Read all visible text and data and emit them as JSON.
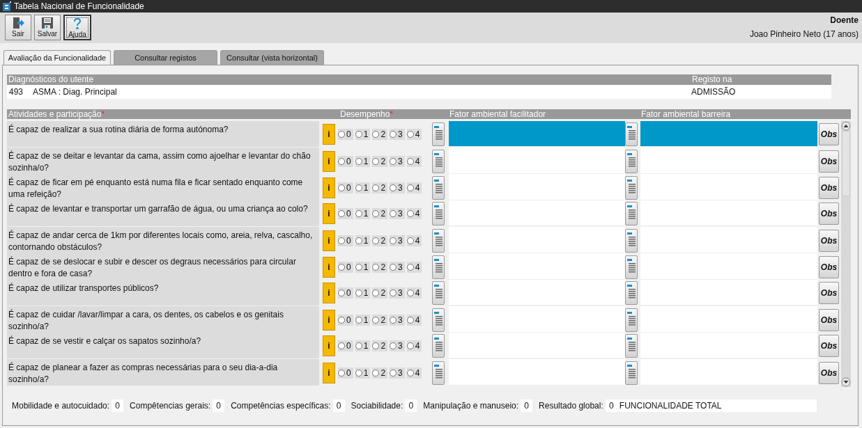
{
  "window": {
    "title": "Tabela Nacional de Funcionalidade"
  },
  "toolbar": {
    "buttons": [
      {
        "label": "Sair",
        "kind": "exit",
        "focused": false
      },
      {
        "label": "Salvar",
        "kind": "save",
        "focused": false
      },
      {
        "label": "Ajuda",
        "kind": "help",
        "focused": true
      }
    ]
  },
  "patient": {
    "heading": "Doente",
    "name": "Joao Pinheiro Neto (17 anos)"
  },
  "tabs": [
    {
      "label": "Avaliação da Funcionalidade",
      "selected": true
    },
    {
      "label": "Consultar registos",
      "selected": false
    },
    {
      "label": "Consultar (vista horizontal)",
      "selected": false
    }
  ],
  "diagnoses": {
    "columns": [
      "Diagnósticos do utente",
      "Registo na"
    ],
    "rows": [
      {
        "code": "493",
        "description": "ASMA : Diag. Principal",
        "registo": "ADMISSÃO"
      }
    ]
  },
  "activities": {
    "columns": [
      {
        "label": "Atividades e participação",
        "required_mark": "*"
      },
      {
        "label": "Desempenho",
        "required_mark": "*"
      },
      {
        "label": "Fator ambiental facilitador"
      },
      {
        "label": "Fator ambiental barreira"
      }
    ],
    "rows": [
      {
        "question": "É capaz de realizar a sua rotina diária de forma autónoma?",
        "selected": true,
        "info": "i",
        "obs": "Obs",
        "options": [
          {
            "label": "0",
            "selected": false
          },
          {
            "label": "1",
            "selected": false
          },
          {
            "label": "2",
            "selected": false
          },
          {
            "label": "3",
            "selected": false
          },
          {
            "label": "4",
            "selected": false
          }
        ]
      },
      {
        "question": "É capaz de se deitar e levantar da cama, assim como ajoelhar e levantar do chão sozinha/o?",
        "selected": false,
        "info": "i",
        "obs": "Obs",
        "options": [
          {
            "label": "0",
            "selected": false
          },
          {
            "label": "1",
            "selected": false
          },
          {
            "label": "2",
            "selected": false
          },
          {
            "label": "3",
            "selected": false
          },
          {
            "label": "4",
            "selected": false
          }
        ]
      },
      {
        "question": "É capaz de ficar em pé enquanto está numa fila e ficar sentado enquanto come uma refeição?",
        "selected": false,
        "info": "i",
        "obs": "Obs",
        "options": [
          {
            "label": "0",
            "selected": false
          },
          {
            "label": "1",
            "selected": false
          },
          {
            "label": "2",
            "selected": false
          },
          {
            "label": "3",
            "selected": false
          },
          {
            "label": "4",
            "selected": false
          }
        ]
      },
      {
        "question": "É capaz de levantar e transportar um garrafão de água, ou uma criança ao colo?",
        "selected": false,
        "info": "i",
        "obs": "Obs",
        "options": [
          {
            "label": "0",
            "selected": false
          },
          {
            "label": "1",
            "selected": false
          },
          {
            "label": "2",
            "selected": false
          },
          {
            "label": "3",
            "selected": false
          },
          {
            "label": "4",
            "selected": false
          }
        ]
      },
      {
        "question": "É capaz de andar cerca de 1km por diferentes locais como, areia, relva, cascalho, contornando obstáculos?",
        "selected": false,
        "info": "i",
        "obs": "Obs",
        "options": [
          {
            "label": "0",
            "selected": false
          },
          {
            "label": "1",
            "selected": false
          },
          {
            "label": "2",
            "selected": false
          },
          {
            "label": "3",
            "selected": false
          },
          {
            "label": "4",
            "selected": false
          }
        ]
      },
      {
        "question": "É capaz de se deslocar e subir e descer os degraus necessários para circular dentro e fora de casa?",
        "selected": false,
        "info": "i",
        "obs": "Obs",
        "options": [
          {
            "label": "0",
            "selected": false
          },
          {
            "label": "1",
            "selected": false
          },
          {
            "label": "2",
            "selected": false
          },
          {
            "label": "3",
            "selected": false
          },
          {
            "label": "4",
            "selected": false
          }
        ]
      },
      {
        "question": "É capaz de utilizar transportes públicos?",
        "selected": false,
        "info": "i",
        "obs": "Obs",
        "options": [
          {
            "label": "0",
            "selected": false
          },
          {
            "label": "1",
            "selected": false
          },
          {
            "label": "2",
            "selected": false
          },
          {
            "label": "3",
            "selected": false
          },
          {
            "label": "4",
            "selected": false
          }
        ]
      },
      {
        "question": "É capaz de cuidar /lavar/limpar a cara, os dentes, os cabelos e os genitais sozinho/a?",
        "selected": false,
        "info": "i",
        "obs": "Obs",
        "options": [
          {
            "label": "0",
            "selected": false
          },
          {
            "label": "1",
            "selected": false
          },
          {
            "label": "2",
            "selected": false
          },
          {
            "label": "3",
            "selected": false
          },
          {
            "label": "4",
            "selected": false
          }
        ]
      },
      {
        "question": "É capaz de se vestir e calçar os sapatos sozinho/a?",
        "selected": false,
        "info": "i",
        "obs": "Obs",
        "options": [
          {
            "label": "0",
            "selected": false
          },
          {
            "label": "1",
            "selected": false
          },
          {
            "label": "2",
            "selected": false
          },
          {
            "label": "3",
            "selected": false
          },
          {
            "label": "4",
            "selected": false
          }
        ]
      },
      {
        "question": "É capaz de planear a fazer as compras necessárias para o seu dia-a-dia sozinho/a?",
        "selected": false,
        "info": "i",
        "obs": "Obs",
        "options": [
          {
            "label": "0",
            "selected": false
          },
          {
            "label": "1",
            "selected": false
          },
          {
            "label": "2",
            "selected": false
          },
          {
            "label": "3",
            "selected": false
          },
          {
            "label": "4",
            "selected": false
          }
        ]
      }
    ]
  },
  "summary": {
    "items": [
      {
        "label": "Mobilidade e autocuidado:",
        "value": "0"
      },
      {
        "label": "Compêtencias gerais:",
        "value": "0"
      },
      {
        "label": "Competências específicas:",
        "value": "0"
      },
      {
        "label": "Sociabilidade:",
        "value": "0"
      },
      {
        "label": "Manipulação e manuseio:",
        "value": "0"
      }
    ],
    "global": {
      "label": "Resultado global:",
      "value": "0",
      "text": "FUNCIONALIDADE TOTAL"
    }
  }
}
